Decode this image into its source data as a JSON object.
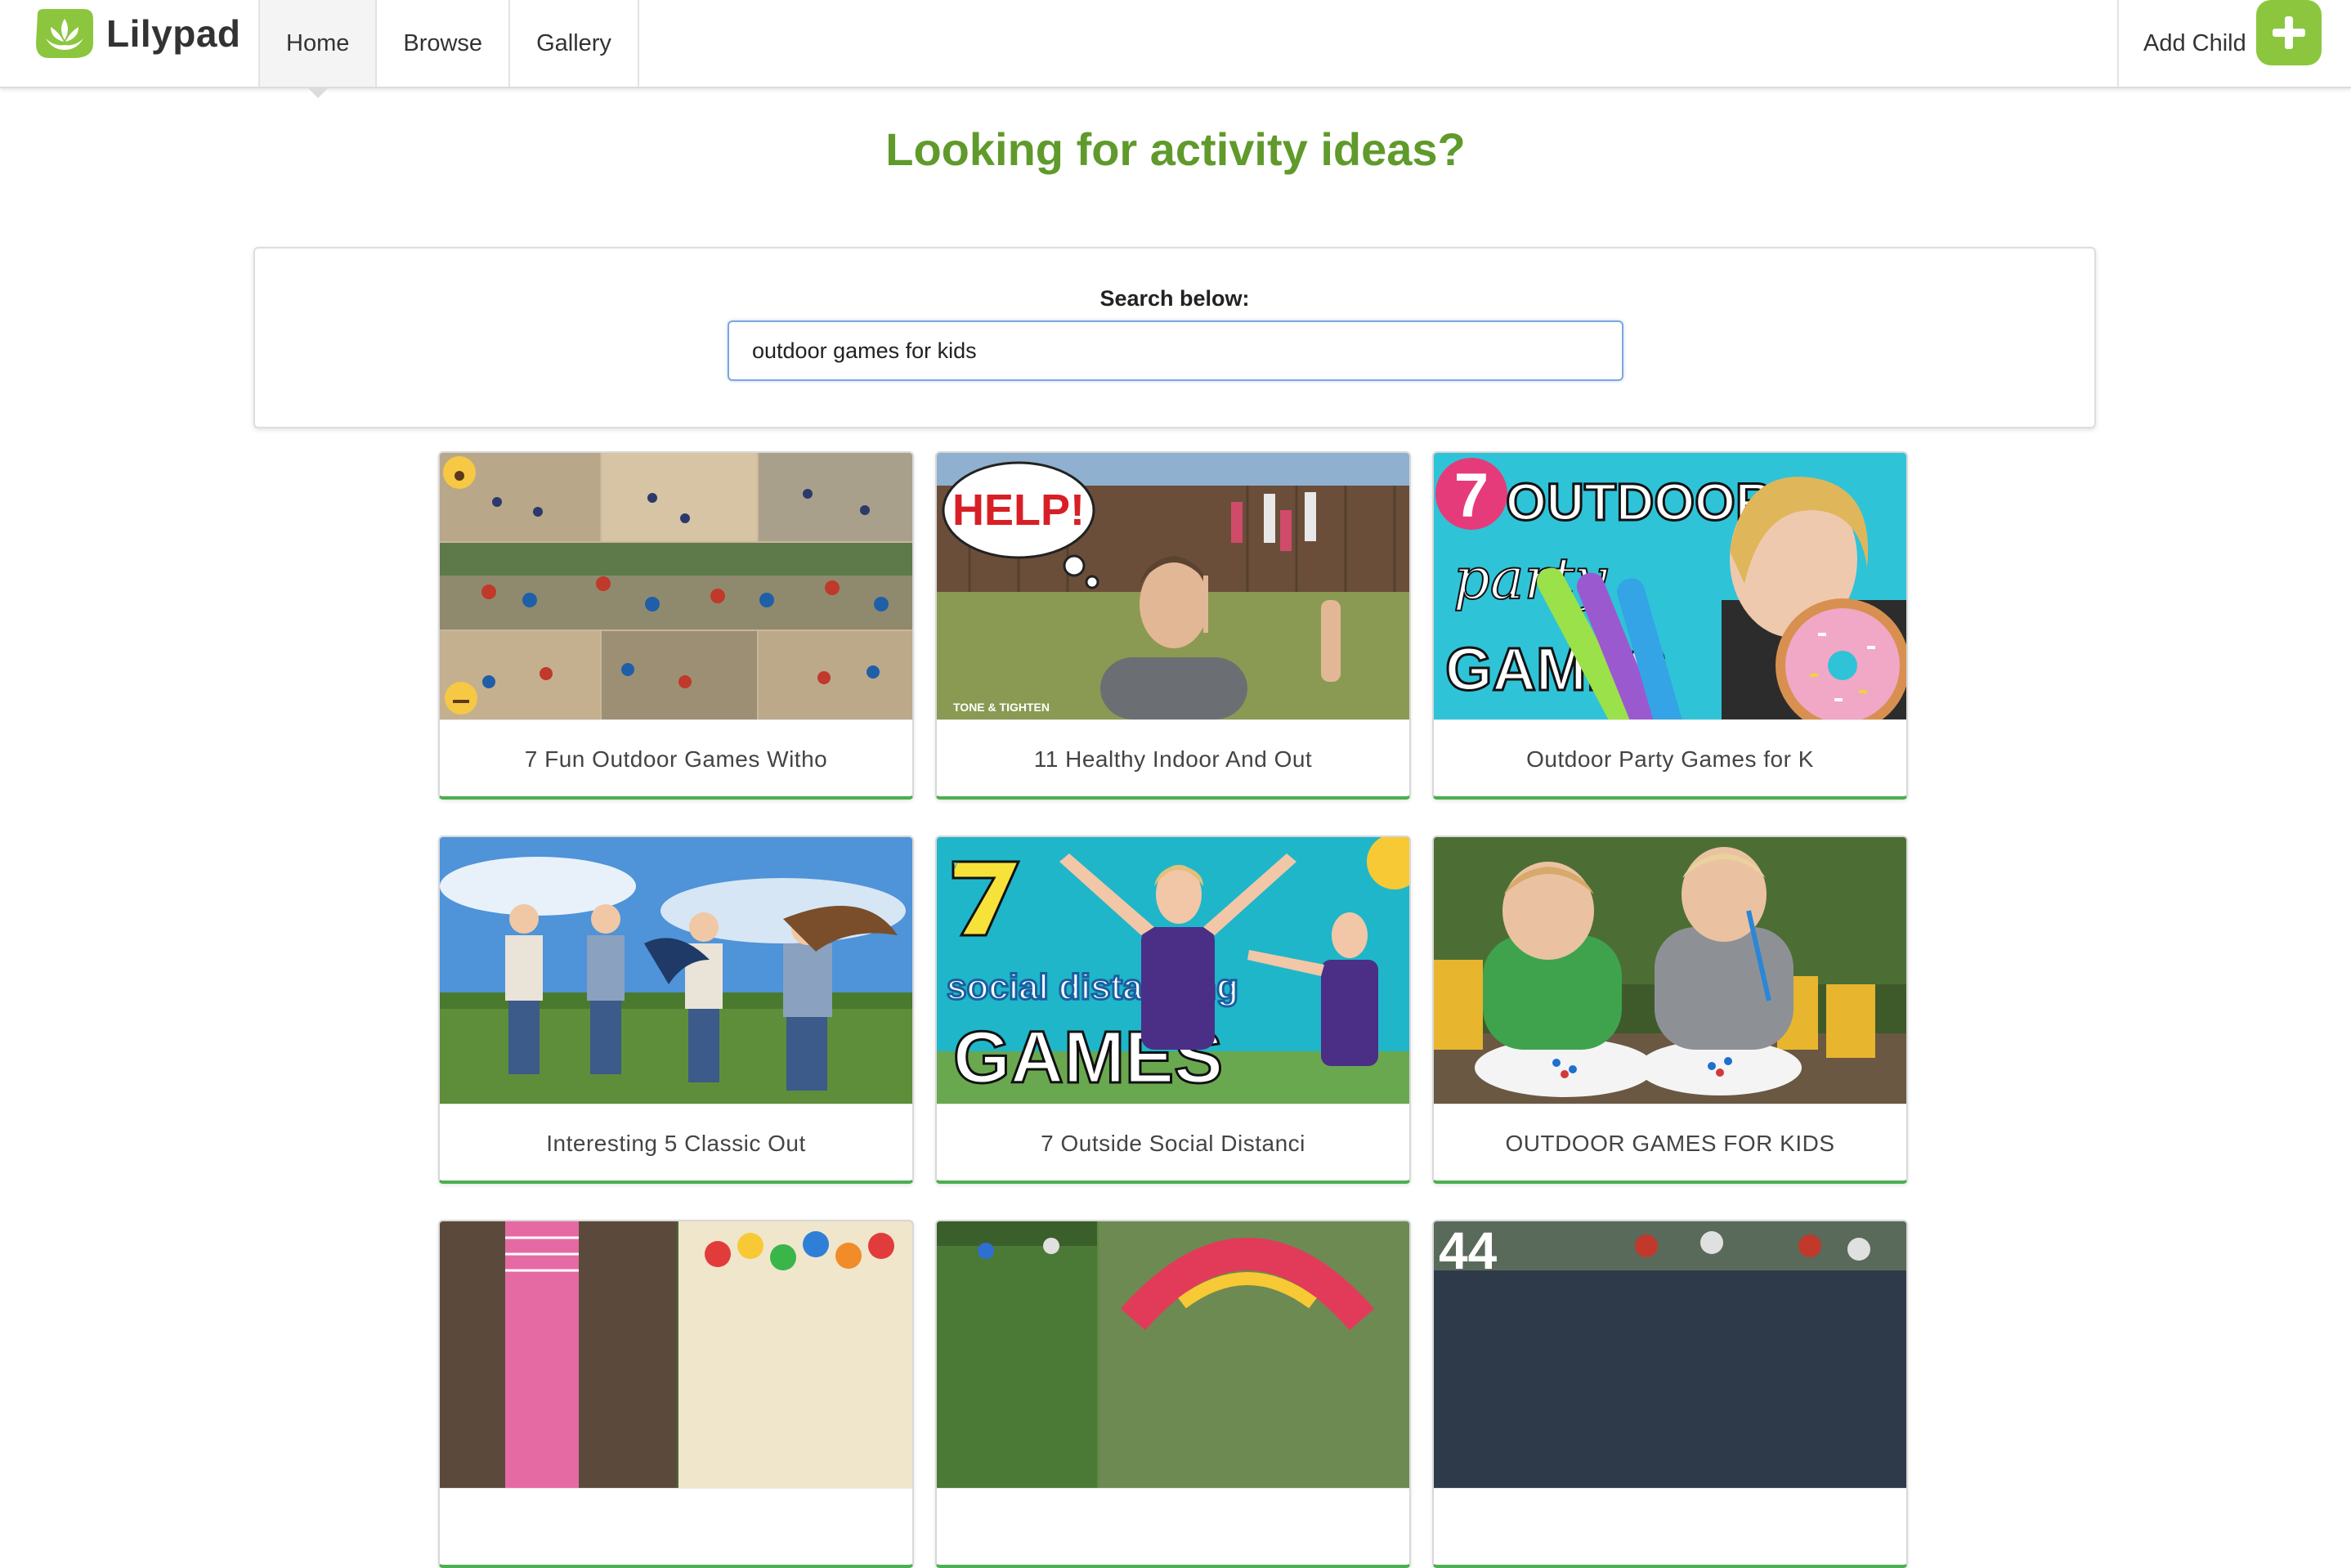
{
  "brand": {
    "name": "Lilypad",
    "icon": "lotus-logo-icon"
  },
  "nav": {
    "tabs": [
      {
        "label": "Home",
        "active": true
      },
      {
        "label": "Browse",
        "active": false
      },
      {
        "label": "Gallery",
        "active": false
      }
    ],
    "add_child_label": "Add Child",
    "add_child_icon": "plus-icon"
  },
  "hero": {
    "title": "Looking for activity ideas?"
  },
  "search": {
    "label": "Search below:",
    "value": "outdoor games for kids"
  },
  "thumb_text": {
    "help": "HELP!",
    "watermark": "TONE & TIGHTEN",
    "seven": "7",
    "outdoor": "OUTDOOR",
    "party": "party",
    "games": "GAMES",
    "social_distancing": "social distancing",
    "fortyfour": "44"
  },
  "cards": [
    {
      "title": "7 Fun Outdoor Games Witho"
    },
    {
      "title": "11 Healthy Indoor And Out"
    },
    {
      "title": "Outdoor Party Games for K"
    },
    {
      "title": "Interesting 5 Classic Out"
    },
    {
      "title": "7 Outside Social Distanci"
    },
    {
      "title": "OUTDOOR GAMES FOR KIDS"
    },
    {
      "title": ""
    },
    {
      "title": ""
    },
    {
      "title": ""
    }
  ],
  "colors": {
    "brand_green": "#8cc63e",
    "heading_green": "#5f9a2b",
    "card_accent": "#4caf50",
    "input_focus": "#7ba7e0"
  }
}
